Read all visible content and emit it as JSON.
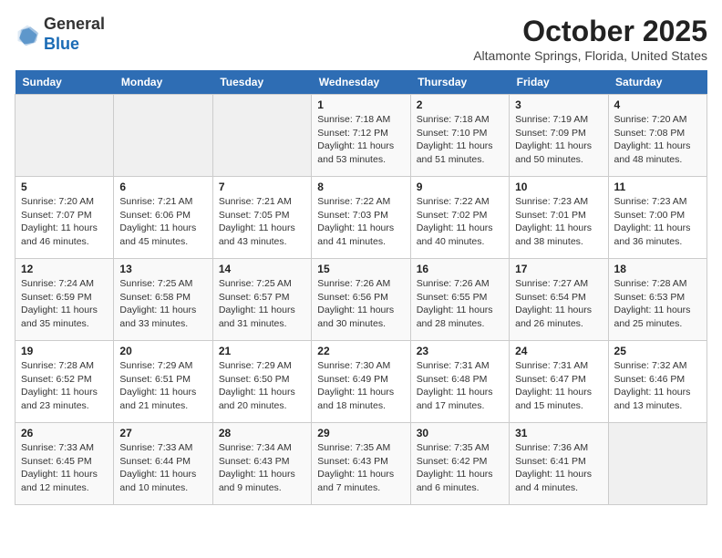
{
  "header": {
    "logo_general": "General",
    "logo_blue": "Blue",
    "month": "October 2025",
    "location": "Altamonte Springs, Florida, United States"
  },
  "weekdays": [
    "Sunday",
    "Monday",
    "Tuesday",
    "Wednesday",
    "Thursday",
    "Friday",
    "Saturday"
  ],
  "weeks": [
    [
      {
        "day": "",
        "sunrise": "",
        "sunset": "",
        "daylight": ""
      },
      {
        "day": "",
        "sunrise": "",
        "sunset": "",
        "daylight": ""
      },
      {
        "day": "",
        "sunrise": "",
        "sunset": "",
        "daylight": ""
      },
      {
        "day": "1",
        "sunrise": "Sunrise: 7:18 AM",
        "sunset": "Sunset: 7:12 PM",
        "daylight": "Daylight: 11 hours and 53 minutes."
      },
      {
        "day": "2",
        "sunrise": "Sunrise: 7:18 AM",
        "sunset": "Sunset: 7:10 PM",
        "daylight": "Daylight: 11 hours and 51 minutes."
      },
      {
        "day": "3",
        "sunrise": "Sunrise: 7:19 AM",
        "sunset": "Sunset: 7:09 PM",
        "daylight": "Daylight: 11 hours and 50 minutes."
      },
      {
        "day": "4",
        "sunrise": "Sunrise: 7:20 AM",
        "sunset": "Sunset: 7:08 PM",
        "daylight": "Daylight: 11 hours and 48 minutes."
      }
    ],
    [
      {
        "day": "5",
        "sunrise": "Sunrise: 7:20 AM",
        "sunset": "Sunset: 7:07 PM",
        "daylight": "Daylight: 11 hours and 46 minutes."
      },
      {
        "day": "6",
        "sunrise": "Sunrise: 7:21 AM",
        "sunset": "Sunset: 6:06 PM",
        "daylight": "Daylight: 11 hours and 45 minutes."
      },
      {
        "day": "7",
        "sunrise": "Sunrise: 7:21 AM",
        "sunset": "Sunset: 7:05 PM",
        "daylight": "Daylight: 11 hours and 43 minutes."
      },
      {
        "day": "8",
        "sunrise": "Sunrise: 7:22 AM",
        "sunset": "Sunset: 7:03 PM",
        "daylight": "Daylight: 11 hours and 41 minutes."
      },
      {
        "day": "9",
        "sunrise": "Sunrise: 7:22 AM",
        "sunset": "Sunset: 7:02 PM",
        "daylight": "Daylight: 11 hours and 40 minutes."
      },
      {
        "day": "10",
        "sunrise": "Sunrise: 7:23 AM",
        "sunset": "Sunset: 7:01 PM",
        "daylight": "Daylight: 11 hours and 38 minutes."
      },
      {
        "day": "11",
        "sunrise": "Sunrise: 7:23 AM",
        "sunset": "Sunset: 7:00 PM",
        "daylight": "Daylight: 11 hours and 36 minutes."
      }
    ],
    [
      {
        "day": "12",
        "sunrise": "Sunrise: 7:24 AM",
        "sunset": "Sunset: 6:59 PM",
        "daylight": "Daylight: 11 hours and 35 minutes."
      },
      {
        "day": "13",
        "sunrise": "Sunrise: 7:25 AM",
        "sunset": "Sunset: 6:58 PM",
        "daylight": "Daylight: 11 hours and 33 minutes."
      },
      {
        "day": "14",
        "sunrise": "Sunrise: 7:25 AM",
        "sunset": "Sunset: 6:57 PM",
        "daylight": "Daylight: 11 hours and 31 minutes."
      },
      {
        "day": "15",
        "sunrise": "Sunrise: 7:26 AM",
        "sunset": "Sunset: 6:56 PM",
        "daylight": "Daylight: 11 hours and 30 minutes."
      },
      {
        "day": "16",
        "sunrise": "Sunrise: 7:26 AM",
        "sunset": "Sunset: 6:55 PM",
        "daylight": "Daylight: 11 hours and 28 minutes."
      },
      {
        "day": "17",
        "sunrise": "Sunrise: 7:27 AM",
        "sunset": "Sunset: 6:54 PM",
        "daylight": "Daylight: 11 hours and 26 minutes."
      },
      {
        "day": "18",
        "sunrise": "Sunrise: 7:28 AM",
        "sunset": "Sunset: 6:53 PM",
        "daylight": "Daylight: 11 hours and 25 minutes."
      }
    ],
    [
      {
        "day": "19",
        "sunrise": "Sunrise: 7:28 AM",
        "sunset": "Sunset: 6:52 PM",
        "daylight": "Daylight: 11 hours and 23 minutes."
      },
      {
        "day": "20",
        "sunrise": "Sunrise: 7:29 AM",
        "sunset": "Sunset: 6:51 PM",
        "daylight": "Daylight: 11 hours and 21 minutes."
      },
      {
        "day": "21",
        "sunrise": "Sunrise: 7:29 AM",
        "sunset": "Sunset: 6:50 PM",
        "daylight": "Daylight: 11 hours and 20 minutes."
      },
      {
        "day": "22",
        "sunrise": "Sunrise: 7:30 AM",
        "sunset": "Sunset: 6:49 PM",
        "daylight": "Daylight: 11 hours and 18 minutes."
      },
      {
        "day": "23",
        "sunrise": "Sunrise: 7:31 AM",
        "sunset": "Sunset: 6:48 PM",
        "daylight": "Daylight: 11 hours and 17 minutes."
      },
      {
        "day": "24",
        "sunrise": "Sunrise: 7:31 AM",
        "sunset": "Sunset: 6:47 PM",
        "daylight": "Daylight: 11 hours and 15 minutes."
      },
      {
        "day": "25",
        "sunrise": "Sunrise: 7:32 AM",
        "sunset": "Sunset: 6:46 PM",
        "daylight": "Daylight: 11 hours and 13 minutes."
      }
    ],
    [
      {
        "day": "26",
        "sunrise": "Sunrise: 7:33 AM",
        "sunset": "Sunset: 6:45 PM",
        "daylight": "Daylight: 11 hours and 12 minutes."
      },
      {
        "day": "27",
        "sunrise": "Sunrise: 7:33 AM",
        "sunset": "Sunset: 6:44 PM",
        "daylight": "Daylight: 11 hours and 10 minutes."
      },
      {
        "day": "28",
        "sunrise": "Sunrise: 7:34 AM",
        "sunset": "Sunset: 6:43 PM",
        "daylight": "Daylight: 11 hours and 9 minutes."
      },
      {
        "day": "29",
        "sunrise": "Sunrise: 7:35 AM",
        "sunset": "Sunset: 6:43 PM",
        "daylight": "Daylight: 11 hours and 7 minutes."
      },
      {
        "day": "30",
        "sunrise": "Sunrise: 7:35 AM",
        "sunset": "Sunset: 6:42 PM",
        "daylight": "Daylight: 11 hours and 6 minutes."
      },
      {
        "day": "31",
        "sunrise": "Sunrise: 7:36 AM",
        "sunset": "Sunset: 6:41 PM",
        "daylight": "Daylight: 11 hours and 4 minutes."
      },
      {
        "day": "",
        "sunrise": "",
        "sunset": "",
        "daylight": ""
      }
    ]
  ]
}
